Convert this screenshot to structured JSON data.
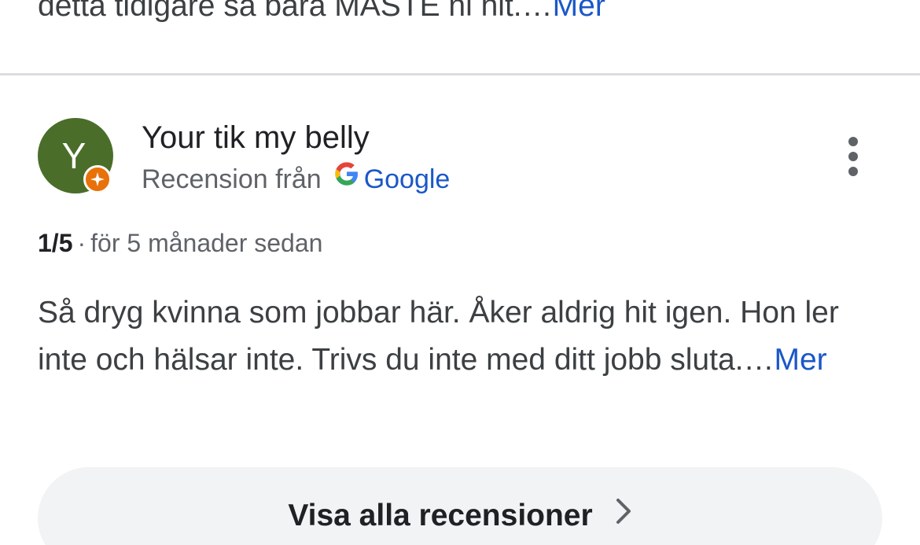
{
  "previous_review": {
    "text_tail": "detta tidigare så bara MÅSTE ni hit.…",
    "more_label": "Mer"
  },
  "review": {
    "avatar_letter": "Y",
    "reviewer_name": "Your tik my belly",
    "source_prefix": "Recension från",
    "source_name": "Google",
    "source_icon": "google-g-icon",
    "badge_icon": "local-guide-badge-icon",
    "rating": "1/5",
    "separator": "·",
    "time_ago": "för 5 månader sedan",
    "text": "Så dryg kvinna som jobbar här. Åker aldrig hit igen. Hon ler inte och hälsar inte. Trivs du inte med ditt jobb sluta.…",
    "more_label": "Mer"
  },
  "footer": {
    "all_reviews_label": "Visa alla recensioner",
    "chevron_icon": "chevron-right-icon"
  },
  "colors": {
    "avatar_bg": "#4a6e2a",
    "badge": "#e8710a",
    "link": "#1a57c9",
    "button_bg": "#f1f3f4"
  }
}
